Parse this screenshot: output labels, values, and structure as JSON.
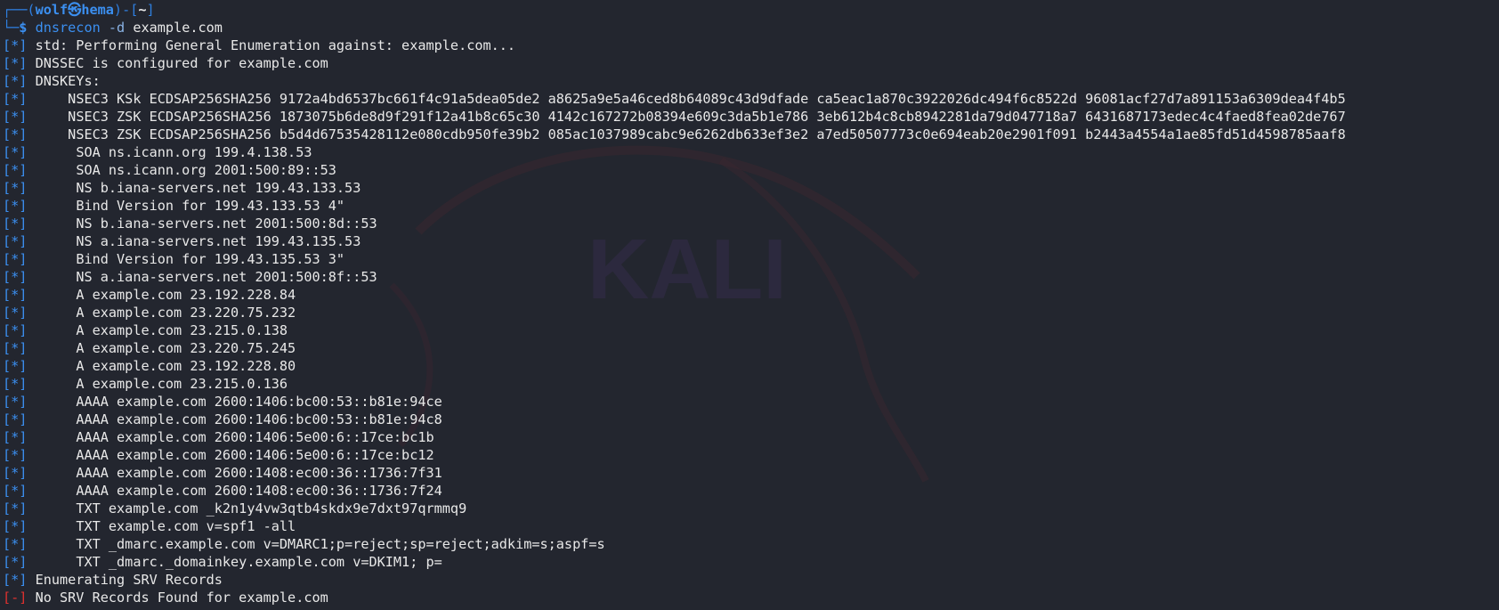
{
  "prompt": {
    "user": "wolf",
    "at_symbol": "㉿",
    "host": "hema",
    "dir": "~",
    "command": "dnsrecon",
    "flag": "-d",
    "argument": "example.com"
  },
  "tags": {
    "info": "[*]",
    "error": "[-]"
  },
  "output": [
    {
      "tag": "info",
      "indent": "",
      "text": "std: Performing General Enumeration against: example.com..."
    },
    {
      "tag": "info",
      "indent": "",
      "text": "DNSSEC is configured for example.com"
    },
    {
      "tag": "info",
      "indent": "",
      "text": "DNSKEYs:"
    },
    {
      "tag": "info",
      "indent": "    ",
      "text": "NSEC3 KSk ECDSAP256SHA256 9172a4bd6537bc661f4c91a5dea05de2 a8625a9e5a46ced8b64089c43d9dfade ca5eac1a870c3922026dc494f6c8522d 96081acf27d7a891153a6309dea4f4b5"
    },
    {
      "tag": "info",
      "indent": "    ",
      "text": "NSEC3 ZSK ECDSAP256SHA256 1873075b6de8d9f291f12a41b8c65c30 4142c167272b08394e609c3da5b1e786 3eb612b4c8cb8942281da79d047718a7 6431687173edec4c4faed8fea02de767"
    },
    {
      "tag": "info",
      "indent": "    ",
      "text": "NSEC3 ZSK ECDSAP256SHA256 b5d4d67535428112e080cdb950fe39b2 085ac1037989cabc9e6262db633ef3e2 a7ed50507773c0e694eab20e2901f091 b2443a4554a1ae85fd51d4598785aaf8"
    },
    {
      "tag": "info",
      "indent": "     ",
      "text": "SOA ns.icann.org 199.4.138.53"
    },
    {
      "tag": "info",
      "indent": "     ",
      "text": "SOA ns.icann.org 2001:500:89::53"
    },
    {
      "tag": "info",
      "indent": "     ",
      "text": "NS b.iana-servers.net 199.43.133.53"
    },
    {
      "tag": "info",
      "indent": "     ",
      "text": "Bind Version for 199.43.133.53 4\""
    },
    {
      "tag": "info",
      "indent": "     ",
      "text": "NS b.iana-servers.net 2001:500:8d::53"
    },
    {
      "tag": "info",
      "indent": "     ",
      "text": "NS a.iana-servers.net 199.43.135.53"
    },
    {
      "tag": "info",
      "indent": "     ",
      "text": "Bind Version for 199.43.135.53 3\""
    },
    {
      "tag": "info",
      "indent": "     ",
      "text": "NS a.iana-servers.net 2001:500:8f::53"
    },
    {
      "tag": "info",
      "indent": "     ",
      "text": "A example.com 23.192.228.84"
    },
    {
      "tag": "info",
      "indent": "     ",
      "text": "A example.com 23.220.75.232"
    },
    {
      "tag": "info",
      "indent": "     ",
      "text": "A example.com 23.215.0.138"
    },
    {
      "tag": "info",
      "indent": "     ",
      "text": "A example.com 23.220.75.245"
    },
    {
      "tag": "info",
      "indent": "     ",
      "text": "A example.com 23.192.228.80"
    },
    {
      "tag": "info",
      "indent": "     ",
      "text": "A example.com 23.215.0.136"
    },
    {
      "tag": "info",
      "indent": "     ",
      "text": "AAAA example.com 2600:1406:bc00:53::b81e:94ce"
    },
    {
      "tag": "info",
      "indent": "     ",
      "text": "AAAA example.com 2600:1406:bc00:53::b81e:94c8"
    },
    {
      "tag": "info",
      "indent": "     ",
      "text": "AAAA example.com 2600:1406:5e00:6::17ce:bc1b"
    },
    {
      "tag": "info",
      "indent": "     ",
      "text": "AAAA example.com 2600:1406:5e00:6::17ce:bc12"
    },
    {
      "tag": "info",
      "indent": "     ",
      "text": "AAAA example.com 2600:1408:ec00:36::1736:7f31"
    },
    {
      "tag": "info",
      "indent": "     ",
      "text": "AAAA example.com 2600:1408:ec00:36::1736:7f24"
    },
    {
      "tag": "info",
      "indent": "     ",
      "text": "TXT example.com _k2n1y4vw3qtb4skdx9e7dxt97qrmmq9"
    },
    {
      "tag": "info",
      "indent": "     ",
      "text": "TXT example.com v=spf1 -all"
    },
    {
      "tag": "info",
      "indent": "     ",
      "text": "TXT _dmarc.example.com v=DMARC1;p=reject;sp=reject;adkim=s;aspf=s"
    },
    {
      "tag": "info",
      "indent": "     ",
      "text": "TXT _dmarc._domainkey.example.com v=DKIM1; p="
    },
    {
      "tag": "info",
      "indent": "",
      "text": "Enumerating SRV Records"
    },
    {
      "tag": "error",
      "indent": "",
      "text": "No SRV Records Found for example.com"
    }
  ],
  "watermark": {
    "text": "KALI"
  },
  "colors": {
    "background": "#23262f",
    "prompt_blue": "#3b8ff0",
    "info_blue": "#3b8ff0",
    "error_red": "#e0312f",
    "foreground": "#e8e8e8"
  }
}
